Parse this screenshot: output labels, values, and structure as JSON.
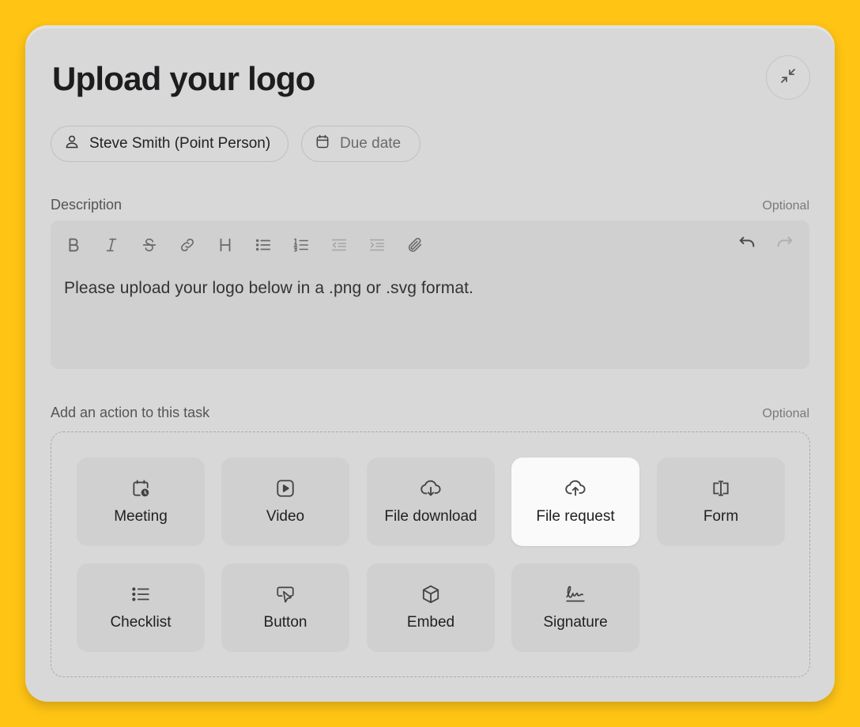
{
  "task": {
    "title": "Upload your logo",
    "assignee": "Steve Smith (Point Person)",
    "due_date_placeholder": "Due date"
  },
  "description": {
    "label": "Description",
    "optional": "Optional",
    "text": "Please upload your logo below in a .png or .svg format.",
    "toolbar": [
      "bold-icon",
      "italic-icon",
      "strikethrough-icon",
      "link-icon",
      "heading-icon",
      "bullet-list-icon",
      "numbered-list-icon",
      "outdent-icon",
      "indent-icon",
      "attachment-icon",
      "undo-icon",
      "redo-icon"
    ]
  },
  "actions": {
    "label": "Add an action to this task",
    "optional": "Optional",
    "selected": "File request",
    "items": [
      {
        "label": "Meeting",
        "icon": "calendar-clock-icon"
      },
      {
        "label": "Video",
        "icon": "video-play-icon"
      },
      {
        "label": "File download",
        "icon": "cloud-download-icon"
      },
      {
        "label": "File request",
        "icon": "cloud-upload-icon"
      },
      {
        "label": "Form",
        "icon": "text-cursor-icon"
      },
      {
        "label": "Checklist",
        "icon": "list-icon"
      },
      {
        "label": "Button",
        "icon": "pointer-click-icon"
      },
      {
        "label": "Embed",
        "icon": "cube-icon"
      },
      {
        "label": "Signature",
        "icon": "signature-icon"
      }
    ]
  }
}
